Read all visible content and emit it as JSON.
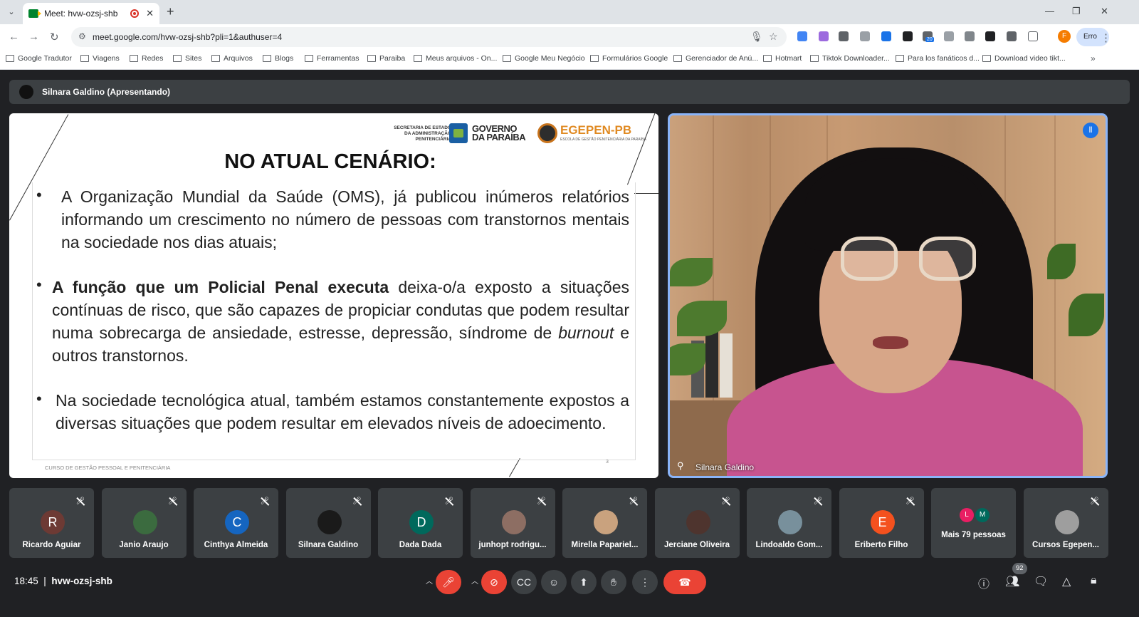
{
  "browser": {
    "tab_title": "Meet: hvw-ozsj-shb",
    "url": "meet.google.com/hvw-ozsj-shb?pli=1&authuser=4",
    "profile_initial": "F",
    "profile_status": "Erro",
    "ext_badge": "20",
    "bookmarks": [
      "Google Tradutor",
      "Viagens",
      "Redes",
      "Sites",
      "Arquivos",
      "Blogs",
      "Ferramentas",
      "Paraiba",
      "Meus arquivos - On...",
      "Google Meu Negócio",
      "Formulários Google",
      "Gerenciador de Anú...",
      "Hotmart",
      "Tiktok Downloader...",
      "Para los fanáticos d...",
      "Download video tikt..."
    ]
  },
  "meet": {
    "presenter_label": "Silnara Galdino (Apresentando)",
    "slide": {
      "logo_secretaria": "SECRETARIA DE ESTADO DA ADMINISTRAÇÃO PENITENCIÁRIA",
      "logo_governo_1": "GOVERNO",
      "logo_governo_2": "DA PARAÍBA",
      "logo_egepen": "EGEPEN-PB",
      "logo_egepen_sub": "ESCOLA DE GESTÃO PENITENCIÁRIA DA PARAÍBA",
      "title": "NO ATUAL CENÁRIO:",
      "bullet1": "A Organização Mundial da Saúde (OMS), já publicou inúmeros relatórios informando um crescimento no número de pessoas com transtornos mentais na sociedade nos dias atuais;",
      "bullet2_bold": "A função que um Policial Penal executa",
      "bullet2_rest": " deixa-o/a exposto a situações contínuas de risco, que são capazes de propiciar condutas que podem resultar numa sobrecarga de ansiedade, estresse, depressão, síndrome de ",
      "bullet2_italic": "burnout",
      "bullet2_end": " e outros transtornos.",
      "bullet3": "Na sociedade tecnológica atual, também estamos constantemente expostos a diversas situações  que podem resultar em elevados níveis de adoecimento.",
      "footer": "CURSO DE GESTÃO PESSOAL E PENITENCIÁRIA",
      "page_number": "3"
    },
    "video_name": "Silnara Galdino",
    "participants": [
      {
        "initial": "R",
        "name": "Ricardo Aguiar",
        "color": "#6d3a34"
      },
      {
        "initial": "",
        "name": "Janio Araujo",
        "color": "#3b6b3f"
      },
      {
        "initial": "C",
        "name": "Cinthya Almeida",
        "color": "#1565c0"
      },
      {
        "initial": "",
        "name": "Silnara Galdino",
        "color": "#1a1a1a"
      },
      {
        "initial": "D",
        "name": "Dada Dada",
        "color": "#00695c"
      },
      {
        "initial": "",
        "name": "junhopt rodrigu...",
        "color": "#8d6e63"
      },
      {
        "initial": "",
        "name": "Mirella Papariel...",
        "color": "#c9a27e"
      },
      {
        "initial": "",
        "name": "Jerciane Oliveira",
        "color": "#4e342e"
      },
      {
        "initial": "",
        "name": "Lindoaldo Gom...",
        "color": "#78909c"
      },
      {
        "initial": "E",
        "name": "Eriberto Filho",
        "color": "#f4511e"
      },
      {
        "initial": "",
        "name": "Mais 79 pessoas",
        "color": ""
      },
      {
        "initial": "",
        "name": "Cursos Egepen...",
        "color": "#9e9e9e"
      }
    ],
    "more_avatars": [
      "L",
      "M"
    ],
    "time": "18:45",
    "meeting_code": "hvw-ozsj-shb",
    "participant_count": "92"
  }
}
